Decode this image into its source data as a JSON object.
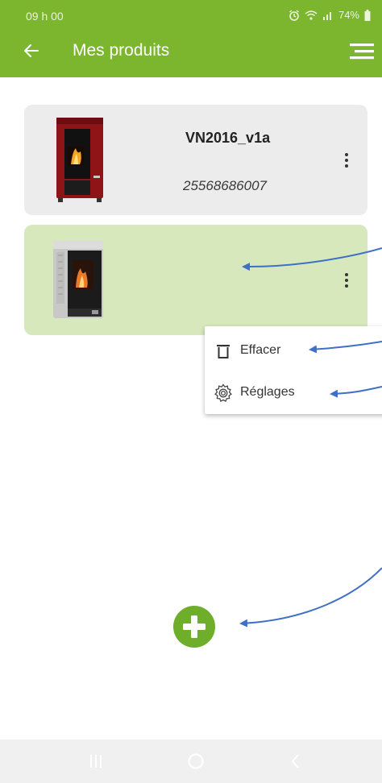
{
  "status_bar": {
    "time": "09 h 00",
    "battery": "74%"
  },
  "header": {
    "title": "Mes produits",
    "back_icon": "arrow-left-icon",
    "menu_icon": "menu-lines-icon",
    "color": "#7cb62e"
  },
  "products": [
    {
      "name": "VN2016_v1a",
      "serial": "25568686007",
      "image_icon": "red-pellet-stove-image",
      "menu_icon": "more-vertical-icon"
    },
    {
      "name": "",
      "serial": "",
      "image_icon": "silver-pellet-stove-image",
      "menu_icon": "more-vertical-icon",
      "selected_color": "#d6e8bc"
    }
  ],
  "context_menu": {
    "items": [
      {
        "label": "Effacer",
        "icon": "trash-icon"
      },
      {
        "label": "Réglages",
        "icon": "gear-icon"
      }
    ]
  },
  "fab": {
    "icon": "plus-icon",
    "color": "#6fae2b"
  },
  "annotation_color": "#3f6fc6",
  "nav_bar": {
    "recent_icon": "recent-apps-icon",
    "home_icon": "home-circle-icon",
    "back_icon": "chevron-left-icon"
  }
}
